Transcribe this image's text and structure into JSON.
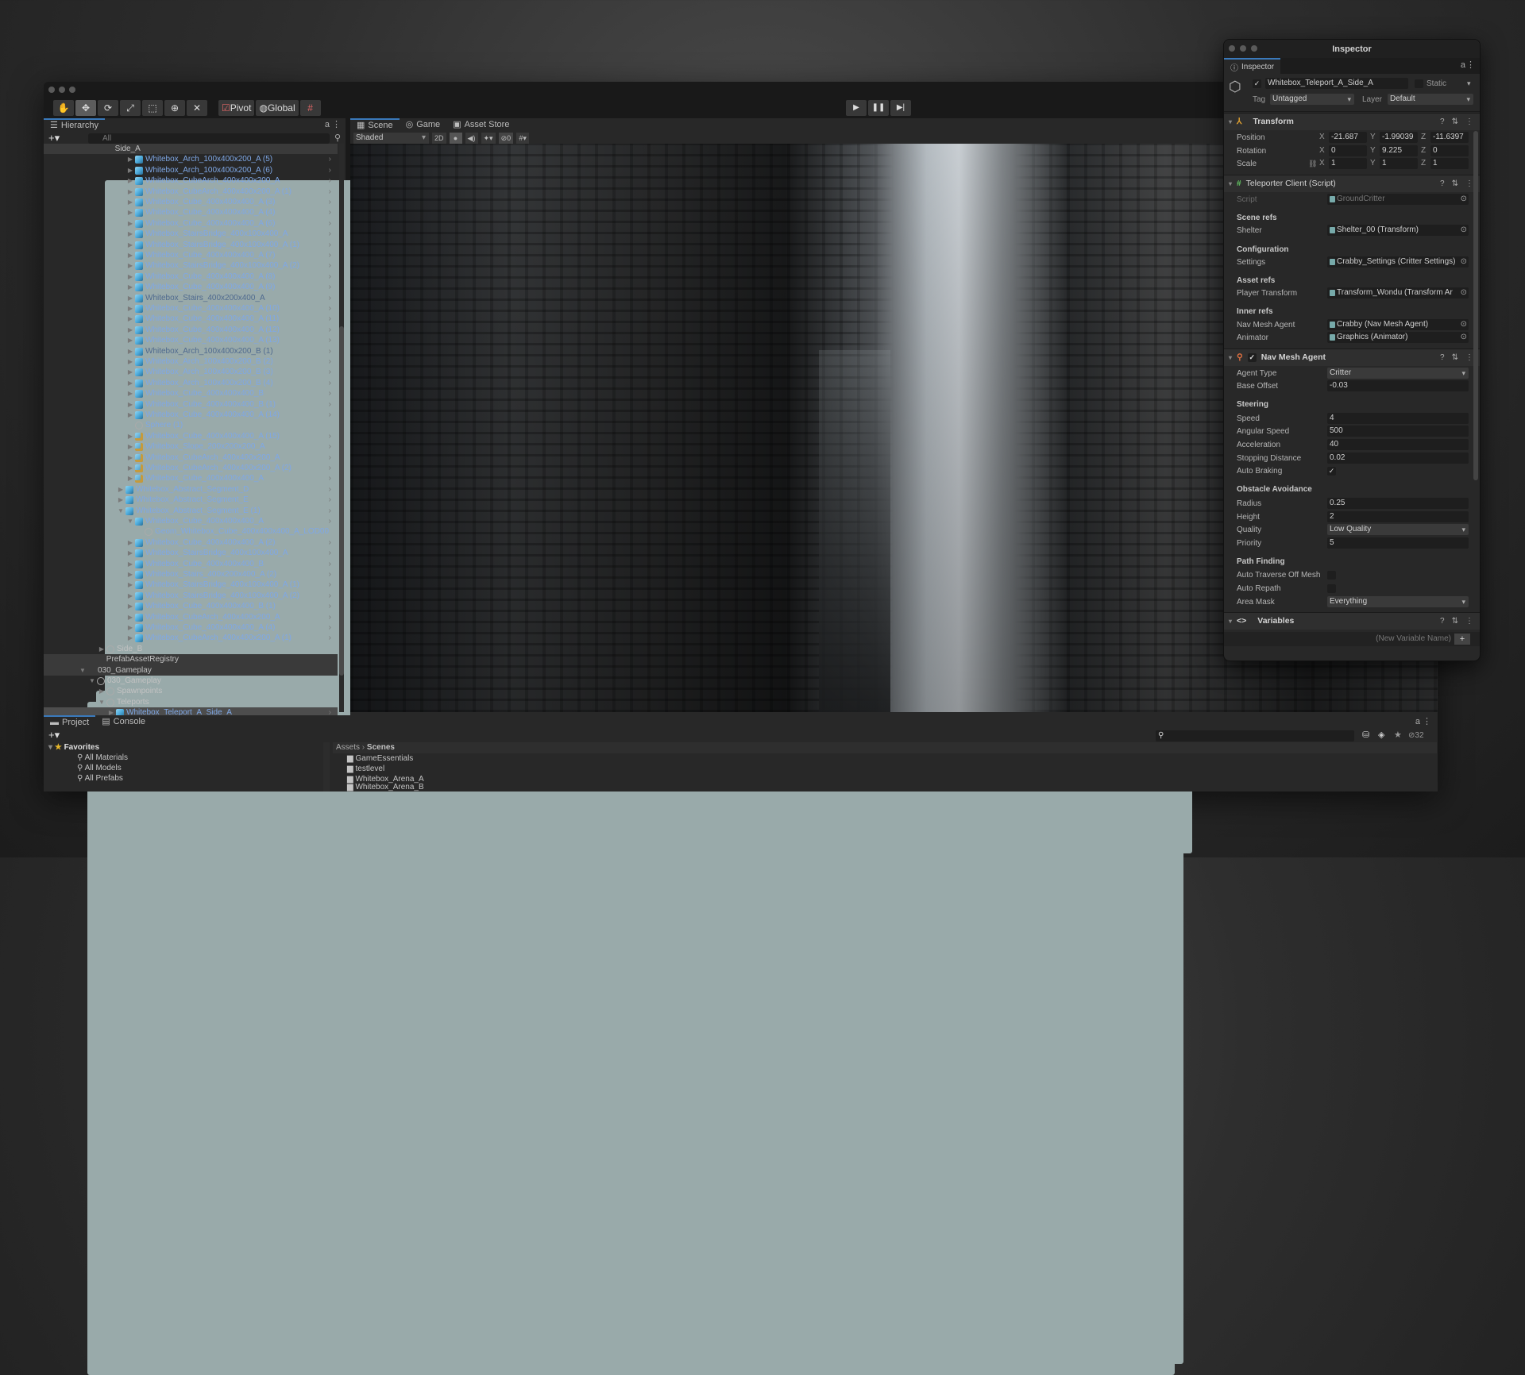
{
  "editor": {
    "toolbar": {
      "tools": [
        "hand-tool",
        "move-tool",
        "rotate-tool",
        "scale-tool",
        "rect-tool",
        "transform-tool",
        "custom-tool"
      ],
      "pivot_label": "Pivot",
      "global_label": "Global"
    },
    "play_controls": [
      "play",
      "pause",
      "step"
    ]
  },
  "hierarchy": {
    "tab_label": "Hierarchy",
    "search_placeholder": "All",
    "items": [
      {
        "name": "Side_A",
        "level": 1.8,
        "expand": "",
        "icon": "scene",
        "style": "go",
        "band": true
      },
      {
        "name": "Whitebox_Arch_100x400x200_A (5)",
        "level": 5,
        "expand": "right",
        "icon": "prefab",
        "style": "prefab"
      },
      {
        "name": "Whitebox_Arch_100x400x200_A (6)",
        "level": 5,
        "expand": "right",
        "icon": "prefab",
        "style": "prefab"
      },
      {
        "name": "Whitebox_CubeArch_400x400x200_A",
        "level": 5,
        "expand": "right",
        "icon": "prefab",
        "style": "prefab"
      },
      {
        "name": "Whitebox_CubeArch_400x400x200_A (1)",
        "level": 5,
        "expand": "right",
        "icon": "prefab",
        "style": "prefab"
      },
      {
        "name": "Whitebox_Cube_400x400x400_A (3)",
        "level": 5,
        "expand": "right",
        "icon": "prefab",
        "style": "prefab"
      },
      {
        "name": "Whitebox_Cube_400x400x400_A (4)",
        "level": 5,
        "expand": "right",
        "icon": "prefab",
        "style": "prefab"
      },
      {
        "name": "Whitebox_Cube_400x400x400_A (6)",
        "level": 5,
        "expand": "right",
        "icon": "prefab",
        "style": "prefab"
      },
      {
        "name": "Whitebox_StairsBridge_400x100x400_A",
        "level": 5,
        "expand": "right",
        "icon": "prefab",
        "style": "prefab"
      },
      {
        "name": "Whitebox_StairsBridge_400x100x400_A (1)",
        "level": 5,
        "expand": "right",
        "icon": "prefab",
        "style": "prefab"
      },
      {
        "name": "Whitebox_Cube_400x400x400_A (7)",
        "level": 5,
        "expand": "right",
        "icon": "prefab",
        "style": "prefab"
      },
      {
        "name": "Whitebox_StairsBridge_400x100x400_A (2)",
        "level": 5,
        "expand": "right",
        "icon": "prefab",
        "style": "prefab"
      },
      {
        "name": "Whitebox_Cube_400x400x400_A (8)",
        "level": 5,
        "expand": "right",
        "icon": "prefab",
        "style": "prefab"
      },
      {
        "name": "Whitebox_Cube_400x400x400_A (9)",
        "level": 5,
        "expand": "right",
        "icon": "prefab",
        "style": "prefab"
      },
      {
        "name": "Whitebox_Stairs_400x200x400_A",
        "level": 5,
        "expand": "right",
        "icon": "prefab",
        "style": "dim"
      },
      {
        "name": "Whitebox_Cube_400x400x400_A (10)",
        "level": 5,
        "expand": "right",
        "icon": "prefab",
        "style": "prefab"
      },
      {
        "name": "Whitebox_Cube_400x400x400_A (11)",
        "level": 5,
        "expand": "right",
        "icon": "prefab",
        "style": "prefab"
      },
      {
        "name": "Whitebox_Cube_400x400x400_A (12)",
        "level": 5,
        "expand": "right",
        "icon": "prefab",
        "style": "prefab"
      },
      {
        "name": "Whitebox_Cube_400x400x400_A (13)",
        "level": 5,
        "expand": "right",
        "icon": "prefab",
        "style": "prefab"
      },
      {
        "name": "Whitebox_Arch_100x400x200_B (1)",
        "level": 5,
        "expand": "right",
        "icon": "prefab",
        "style": "dim"
      },
      {
        "name": "Whitebox_Arch_100x400x200_B (2)",
        "level": 5,
        "expand": "right",
        "icon": "prefab",
        "style": "prefab"
      },
      {
        "name": "Whitebox_Arch_100x400x200_B (3)",
        "level": 5,
        "expand": "right",
        "icon": "prefab",
        "style": "prefab"
      },
      {
        "name": "Whitebox_Arch_100x400x200_B (4)",
        "level": 5,
        "expand": "right",
        "icon": "prefab",
        "style": "prefab"
      },
      {
        "name": "Whitebox_Cube_400x400x400_B",
        "level": 5,
        "expand": "right",
        "icon": "prefab",
        "style": "prefab"
      },
      {
        "name": "Whitebox_Cube_400x400x400_B (1)",
        "level": 5,
        "expand": "right",
        "icon": "prefab",
        "style": "prefab"
      },
      {
        "name": "Whitebox_Cube_400x400x400_A (14)",
        "level": 5,
        "expand": "right",
        "icon": "prefab",
        "style": "prefab"
      },
      {
        "name": "Sphere (1)",
        "level": 5,
        "expand": "",
        "icon": "go",
        "style": "prefab"
      },
      {
        "name": "Whitebox_Cube_400x400x400_A (15)",
        "level": 5,
        "expand": "right",
        "icon": "variant",
        "style": "prefab"
      },
      {
        "name": "Whitebox_Slope_200x200x200_A",
        "level": 5,
        "expand": "right",
        "icon": "variant",
        "style": "prefab"
      },
      {
        "name": "Whitebox_CubeArch_400x400x200_A",
        "level": 5,
        "expand": "right",
        "icon": "variant",
        "style": "prefab"
      },
      {
        "name": "Whitebox_CubeArch_400x400x200_A (2)",
        "level": 5,
        "expand": "right",
        "icon": "variant",
        "style": "prefab"
      },
      {
        "name": "Whitebox_Cube_400x400x400_A",
        "level": 5,
        "expand": "right",
        "icon": "variant",
        "style": "prefab"
      },
      {
        "name": "Whitebox_Abstract_Segment_D",
        "level": 4,
        "expand": "right",
        "icon": "prefab",
        "style": "prefab"
      },
      {
        "name": "Whitebox_Abstract_Segment_E",
        "level": 4,
        "expand": "right",
        "icon": "prefab",
        "style": "prefab"
      },
      {
        "name": "Whitebox_Abstract_Segment_E (1)",
        "level": 4,
        "expand": "down",
        "icon": "prefab",
        "style": "prefab"
      },
      {
        "name": "Whitebox_Cube_400x400x400_A",
        "level": 5,
        "expand": "down",
        "icon": "prefab",
        "style": "prefab"
      },
      {
        "name": "Geom_Whitebox_Cube_400x400x400_A_LOD00",
        "level": 6,
        "expand": "",
        "icon": "go",
        "style": "prefab"
      },
      {
        "name": "Whitebox_Cube_400x400x400_A (2)",
        "level": 5,
        "expand": "right",
        "icon": "prefab",
        "style": "prefab"
      },
      {
        "name": "Whitebox_StairsBridge_400x100x400_A",
        "level": 5,
        "expand": "right",
        "icon": "prefab",
        "style": "prefab"
      },
      {
        "name": "Whitebox_Cube_400x400x400_B",
        "level": 5,
        "expand": "right",
        "icon": "prefab",
        "style": "prefab"
      },
      {
        "name": "Whitebox_Stairs_400x200x400_A (2)",
        "level": 5,
        "expand": "right",
        "icon": "prefab",
        "style": "prefab"
      },
      {
        "name": "Whitebox_StairsBridge_400x100x400_A (1)",
        "level": 5,
        "expand": "right",
        "icon": "prefab",
        "style": "prefab"
      },
      {
        "name": "Whitebox_StairsBridge_400x100x400_A (2)",
        "level": 5,
        "expand": "right",
        "icon": "prefab",
        "style": "prefab"
      },
      {
        "name": "Whitebox_Cube_400x400x400_B (1)",
        "level": 5,
        "expand": "right",
        "icon": "prefab",
        "style": "prefab"
      },
      {
        "name": "Whitebox_CubeArch_400x400x200_A",
        "level": 5,
        "expand": "right",
        "icon": "prefab",
        "style": "prefab"
      },
      {
        "name": "Whitebox_Cube_400x400x400_A (4)",
        "level": 5,
        "expand": "right",
        "icon": "prefab",
        "style": "prefab"
      },
      {
        "name": "Whitebox_CubeArch_400x400x200_A (1)",
        "level": 5,
        "expand": "right",
        "icon": "prefab",
        "style": "prefab"
      },
      {
        "name": "Side_B",
        "level": 2,
        "expand": "right",
        "icon": "go",
        "style": "go"
      },
      {
        "name": "PrefabAssetRegistry",
        "level": 0.9,
        "expand": "",
        "icon": "scene",
        "style": "go",
        "band": true
      },
      {
        "name": "030_Gameplay",
        "level": 0,
        "expand": "down",
        "icon": "scene",
        "style": "go",
        "band": true
      },
      {
        "name": "030_Gameplay",
        "level": 1,
        "expand": "down",
        "icon": "go",
        "style": "go"
      },
      {
        "name": "Spawnpoints",
        "level": 2,
        "expand": "right",
        "icon": "go",
        "style": "go"
      },
      {
        "name": "Teleports",
        "level": 2,
        "expand": "down",
        "icon": "go",
        "style": "go"
      },
      {
        "name": "Whitebox_Teleport_A_Side_A",
        "level": 3,
        "expand": "right",
        "icon": "prefab",
        "style": "prefab",
        "selected": true
      }
    ]
  },
  "scene_view": {
    "tabs": [
      "Scene",
      "Game",
      "Asset Store"
    ],
    "shading_mode": "Shaded",
    "mode_2d": "2D",
    "hidden_count": "0"
  },
  "project": {
    "tabs": [
      "Project",
      "Console"
    ],
    "favorites_label": "Favorites",
    "favorites": [
      "All Materials",
      "All Models",
      "All Prefabs"
    ],
    "breadcrumb": [
      "Assets",
      "Scenes"
    ],
    "folders": [
      "GameEssentials",
      "testlevel",
      "Whitebox_Arena_A",
      "Whitebox_Arena_B"
    ],
    "hidden_count": "32"
  },
  "inspector": {
    "window_title": "Inspector",
    "tab_label": "Inspector",
    "object_name": "Whitebox_Teleport_A_Side_A",
    "static_label": "Static",
    "tag_label": "Tag",
    "tag_value": "Untagged",
    "layer_label": "Layer",
    "layer_value": "Default",
    "transform": {
      "title": "Transform",
      "position": {
        "label": "Position",
        "x": "-21.687",
        "y": "-1.99039",
        "z": "-11.6397"
      },
      "rotation": {
        "label": "Rotation",
        "x": "0",
        "y": "9.225",
        "z": "0"
      },
      "scale": {
        "label": "Scale",
        "x": "1",
        "y": "1",
        "z": "1"
      }
    },
    "teleporter": {
      "title": "Teleporter Client  (Script)",
      "script_label": "Script",
      "script_value": "GroundCritter",
      "scene_refs": "Scene refs",
      "shelter_label": "Shelter",
      "shelter_value": "Shelter_00 (Transform)",
      "configuration": "Configuration",
      "settings_label": "Settings",
      "settings_value": "Crabby_Settings (Critter Settings)",
      "asset_refs": "Asset refs",
      "player_label": "Player Transform",
      "player_value": "Transform_Wondu (Transform Ar",
      "inner_refs": "Inner refs",
      "navagent_label": "Nav Mesh Agent",
      "navagent_value": "Crabby (Nav Mesh Agent)",
      "animator_label": "Animator",
      "animator_value": "Graphics (Animator)"
    },
    "nav_mesh_agent": {
      "title": "Nav Mesh Agent",
      "agent_type": {
        "label": "Agent Type",
        "value": "Critter"
      },
      "base_offset": {
        "label": "Base Offset",
        "value": "-0.03"
      },
      "steering": "Steering",
      "speed": {
        "label": "Speed",
        "value": "4"
      },
      "angular_speed": {
        "label": "Angular Speed",
        "value": "500"
      },
      "acceleration": {
        "label": "Acceleration",
        "value": "40"
      },
      "stopping_distance": {
        "label": "Stopping Distance",
        "value": "0.02"
      },
      "auto_braking": {
        "label": "Auto Braking",
        "checked": true
      },
      "obstacle_avoidance": "Obstacle Avoidance",
      "radius": {
        "label": "Radius",
        "value": "0.25"
      },
      "height": {
        "label": "Height",
        "value": "2"
      },
      "quality": {
        "label": "Quality",
        "value": "Low Quality"
      },
      "priority": {
        "label": "Priority",
        "value": "5"
      },
      "path_finding": "Path Finding",
      "auto_traverse": {
        "label": "Auto Traverse Off Mesh",
        "checked": false
      },
      "auto_repath": {
        "label": "Auto Repath",
        "checked": false
      },
      "area_mask": {
        "label": "Area Mask",
        "value": "Everything"
      }
    },
    "variables": {
      "title": "Variables",
      "new_variable_placeholder": "(New Variable Name)",
      "add_label": "+"
    }
  }
}
